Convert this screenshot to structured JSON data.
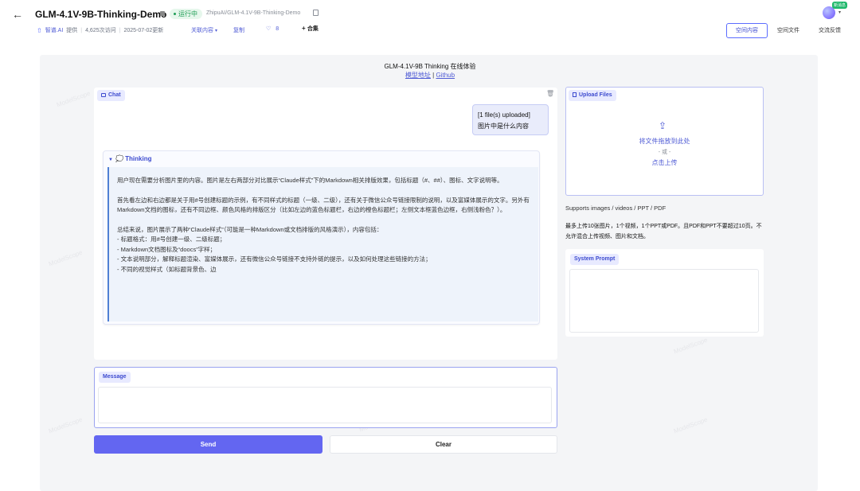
{
  "header": {
    "title": "GLM-4.1V-9B-Thinking-Demo",
    "status": "运行中",
    "repo_path": "ZhipuAI/GLM-4.1V-9B-Thinking-Demo",
    "provider": "智谱.AI",
    "provided_by": "提供",
    "visits": "4,625次访问",
    "updated": "2025-07-02更新",
    "related": "关联内容",
    "copy": "复制",
    "likes": "8",
    "collection": "合集",
    "new_badge": "新消息"
  },
  "tabs": [
    {
      "label": "空间内容",
      "active": true
    },
    {
      "label": "空间文件",
      "active": false
    },
    {
      "label": "交流反馈",
      "active": false
    }
  ],
  "app": {
    "title": "GLM-4.1V-9B Thinking 在线体验",
    "model_link": "模型地址",
    "separator": "|",
    "github_link": "Github"
  },
  "chat": {
    "label": "Chat",
    "user_message": {
      "line1": "[1 file(s) uploaded]",
      "line2": "图片中是什么内容"
    },
    "thinking": {
      "label": "Thinking",
      "paragraphs": [
        "用户现在需要分析图片里的内容。图片是左右两部分对比展示“Claude样式”下的Markdown相关排版效果，包括标题（#、##）、图标、文字说明等。",
        "首先看左边和右边都是关于用#号创建标题的示例，有不同样式的标题（一级、二级），还有关于微信公众号链接限制的说明，以及富媒体展示的文字。另外有Markdown文档的图标，还有不同边框、颜色风格的排版区分（比如左边的蓝色标题栏，右边的橙色标题栏；左侧文本框蓝色边框，右侧浅粉色？）。",
        "总结来说，图片展示了两种“Claude样式”（可能是一种Markdown或文档排版的风格演示），内容包括："
      ],
      "bullets": [
        "- 标题格式：用#号创建一级、二级标题；",
        "- Markdown文档图标及“doocs”字样；",
        "- 文本说明部分，解释标题渲染、富媒体展示，还有微信公众号链接不支持外链的提示，以及如何处理这些链接的方法；",
        "- 不同的视觉样式（如标题背景色、边"
      ]
    }
  },
  "message": {
    "label": "Message",
    "value": "",
    "placeholder": ""
  },
  "buttons": {
    "send": "Send",
    "clear": "Clear"
  },
  "upload": {
    "label": "Upload Files",
    "drop_text": "将文件拖放到此处",
    "or_text": "- 或 -",
    "click_text": "点击上传",
    "supports": "Supports images / videos / PPT / PDF",
    "limit": "最多上传10张图片，1个视频，1个PPT或PDF。且PDF和PPT不要超过10页。不允许混合上传视频、图片和文档。"
  },
  "system_prompt": {
    "label": "System Prompt",
    "value": ""
  },
  "watermark": "ModelScope",
  "colors": {
    "accent": "#6366f1",
    "link": "#4f5bd5",
    "status_green": "#1f9d55"
  }
}
